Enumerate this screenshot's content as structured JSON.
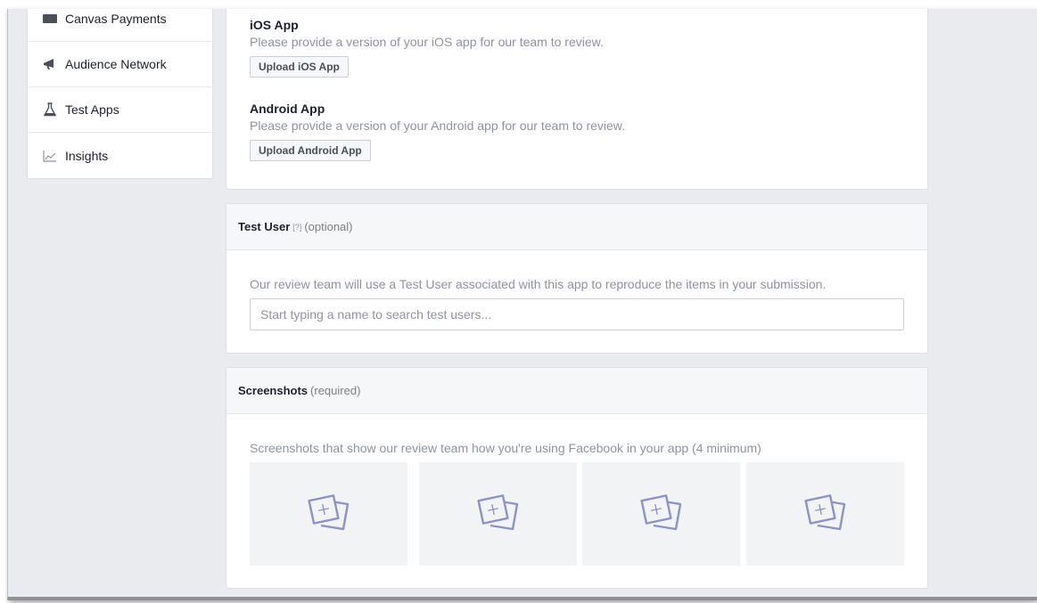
{
  "sidebar": {
    "items": [
      {
        "label": "Canvas Payments",
        "icon": "credit-card-icon"
      },
      {
        "label": "Audience Network",
        "icon": "megaphone-icon"
      },
      {
        "label": "Test Apps",
        "icon": "flask-icon"
      },
      {
        "label": "Insights",
        "icon": "chart-icon"
      }
    ]
  },
  "platforms": {
    "ios": {
      "title": "iOS App",
      "description": "Please provide a version of your iOS app for our team to review.",
      "button": "Upload iOS App"
    },
    "android": {
      "title": "Android App",
      "description": "Please provide a version of your Android app for our team to review.",
      "button": "Upload Android App"
    }
  },
  "test_user": {
    "title": "Test User",
    "help": "[?]",
    "note": "(optional)",
    "description": "Our review team will use a Test User associated with this app to reproduce the items in your submission.",
    "search_placeholder": "Start typing a name to search test users..."
  },
  "screenshots": {
    "title": "Screenshots",
    "note": "(required)",
    "description": "Screenshots that show our review team how you're using Facebook in your app (4 minimum)",
    "slots": [
      "add-screenshot-icon",
      "add-screenshot-icon",
      "add-screenshot-icon",
      "add-screenshot-icon"
    ]
  },
  "colors": {
    "page_bg": "#e9ebee",
    "icon_accent": "#8b93c7"
  }
}
